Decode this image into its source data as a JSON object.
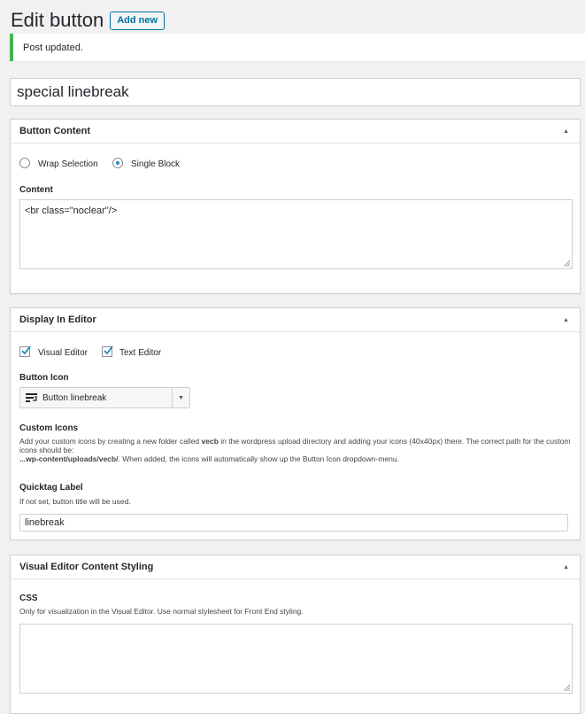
{
  "header": {
    "title": "Edit button",
    "add_new": "Add new"
  },
  "notice": {
    "text": "Post updated."
  },
  "post_title": "special linebreak",
  "button_content": {
    "title": "Button Content",
    "radio_options": [
      {
        "label": "Wrap Selection",
        "checked": false
      },
      {
        "label": "Single Block",
        "checked": true
      }
    ],
    "content_label": "Content",
    "content_value": "<br class=\"noclear\"/>"
  },
  "display_in_editor": {
    "title": "Display In Editor",
    "checkboxes": [
      {
        "label": "Visual Editor",
        "checked": true
      },
      {
        "label": "Text Editor",
        "checked": true
      }
    ],
    "button_icon_label": "Button Icon",
    "button_icon_value": "Button linebreak",
    "custom_icons_label": "Custom Icons",
    "custom_icons_desc_1": "Add your custom icons by creating a new folder called ",
    "custom_icons_folder": "vecb",
    "custom_icons_desc_2": " in the wordpress upload directory and adding your icons (40x40px) there. The correct path for the custom icons should be:",
    "custom_icons_path": "...wp-content/uploads/vecb/",
    "custom_icons_desc_3": ". When added, the icons will automatically show up the Button Icon dropdown-menu.",
    "quicktag_label": "Quicktag Label",
    "quicktag_desc": "If not set, button title will be used.",
    "quicktag_value": "linebreak"
  },
  "visual_styling": {
    "title": "Visual Editor Content Styling",
    "css_label": "CSS",
    "css_desc": "Only for visualization in the Visual Editor. Use normal stylesheet for Front End styling.",
    "css_value": ""
  },
  "colors": {
    "accent": "#0071a1",
    "success": "#46b450",
    "check": "#1e8cbe"
  },
  "icons": [
    "toggle-arrow-icon",
    "checkmark-icon",
    "radio-dot-icon",
    "resize-handle-icon",
    "linebreak-icon",
    "dropdown-arrow-icon"
  ]
}
